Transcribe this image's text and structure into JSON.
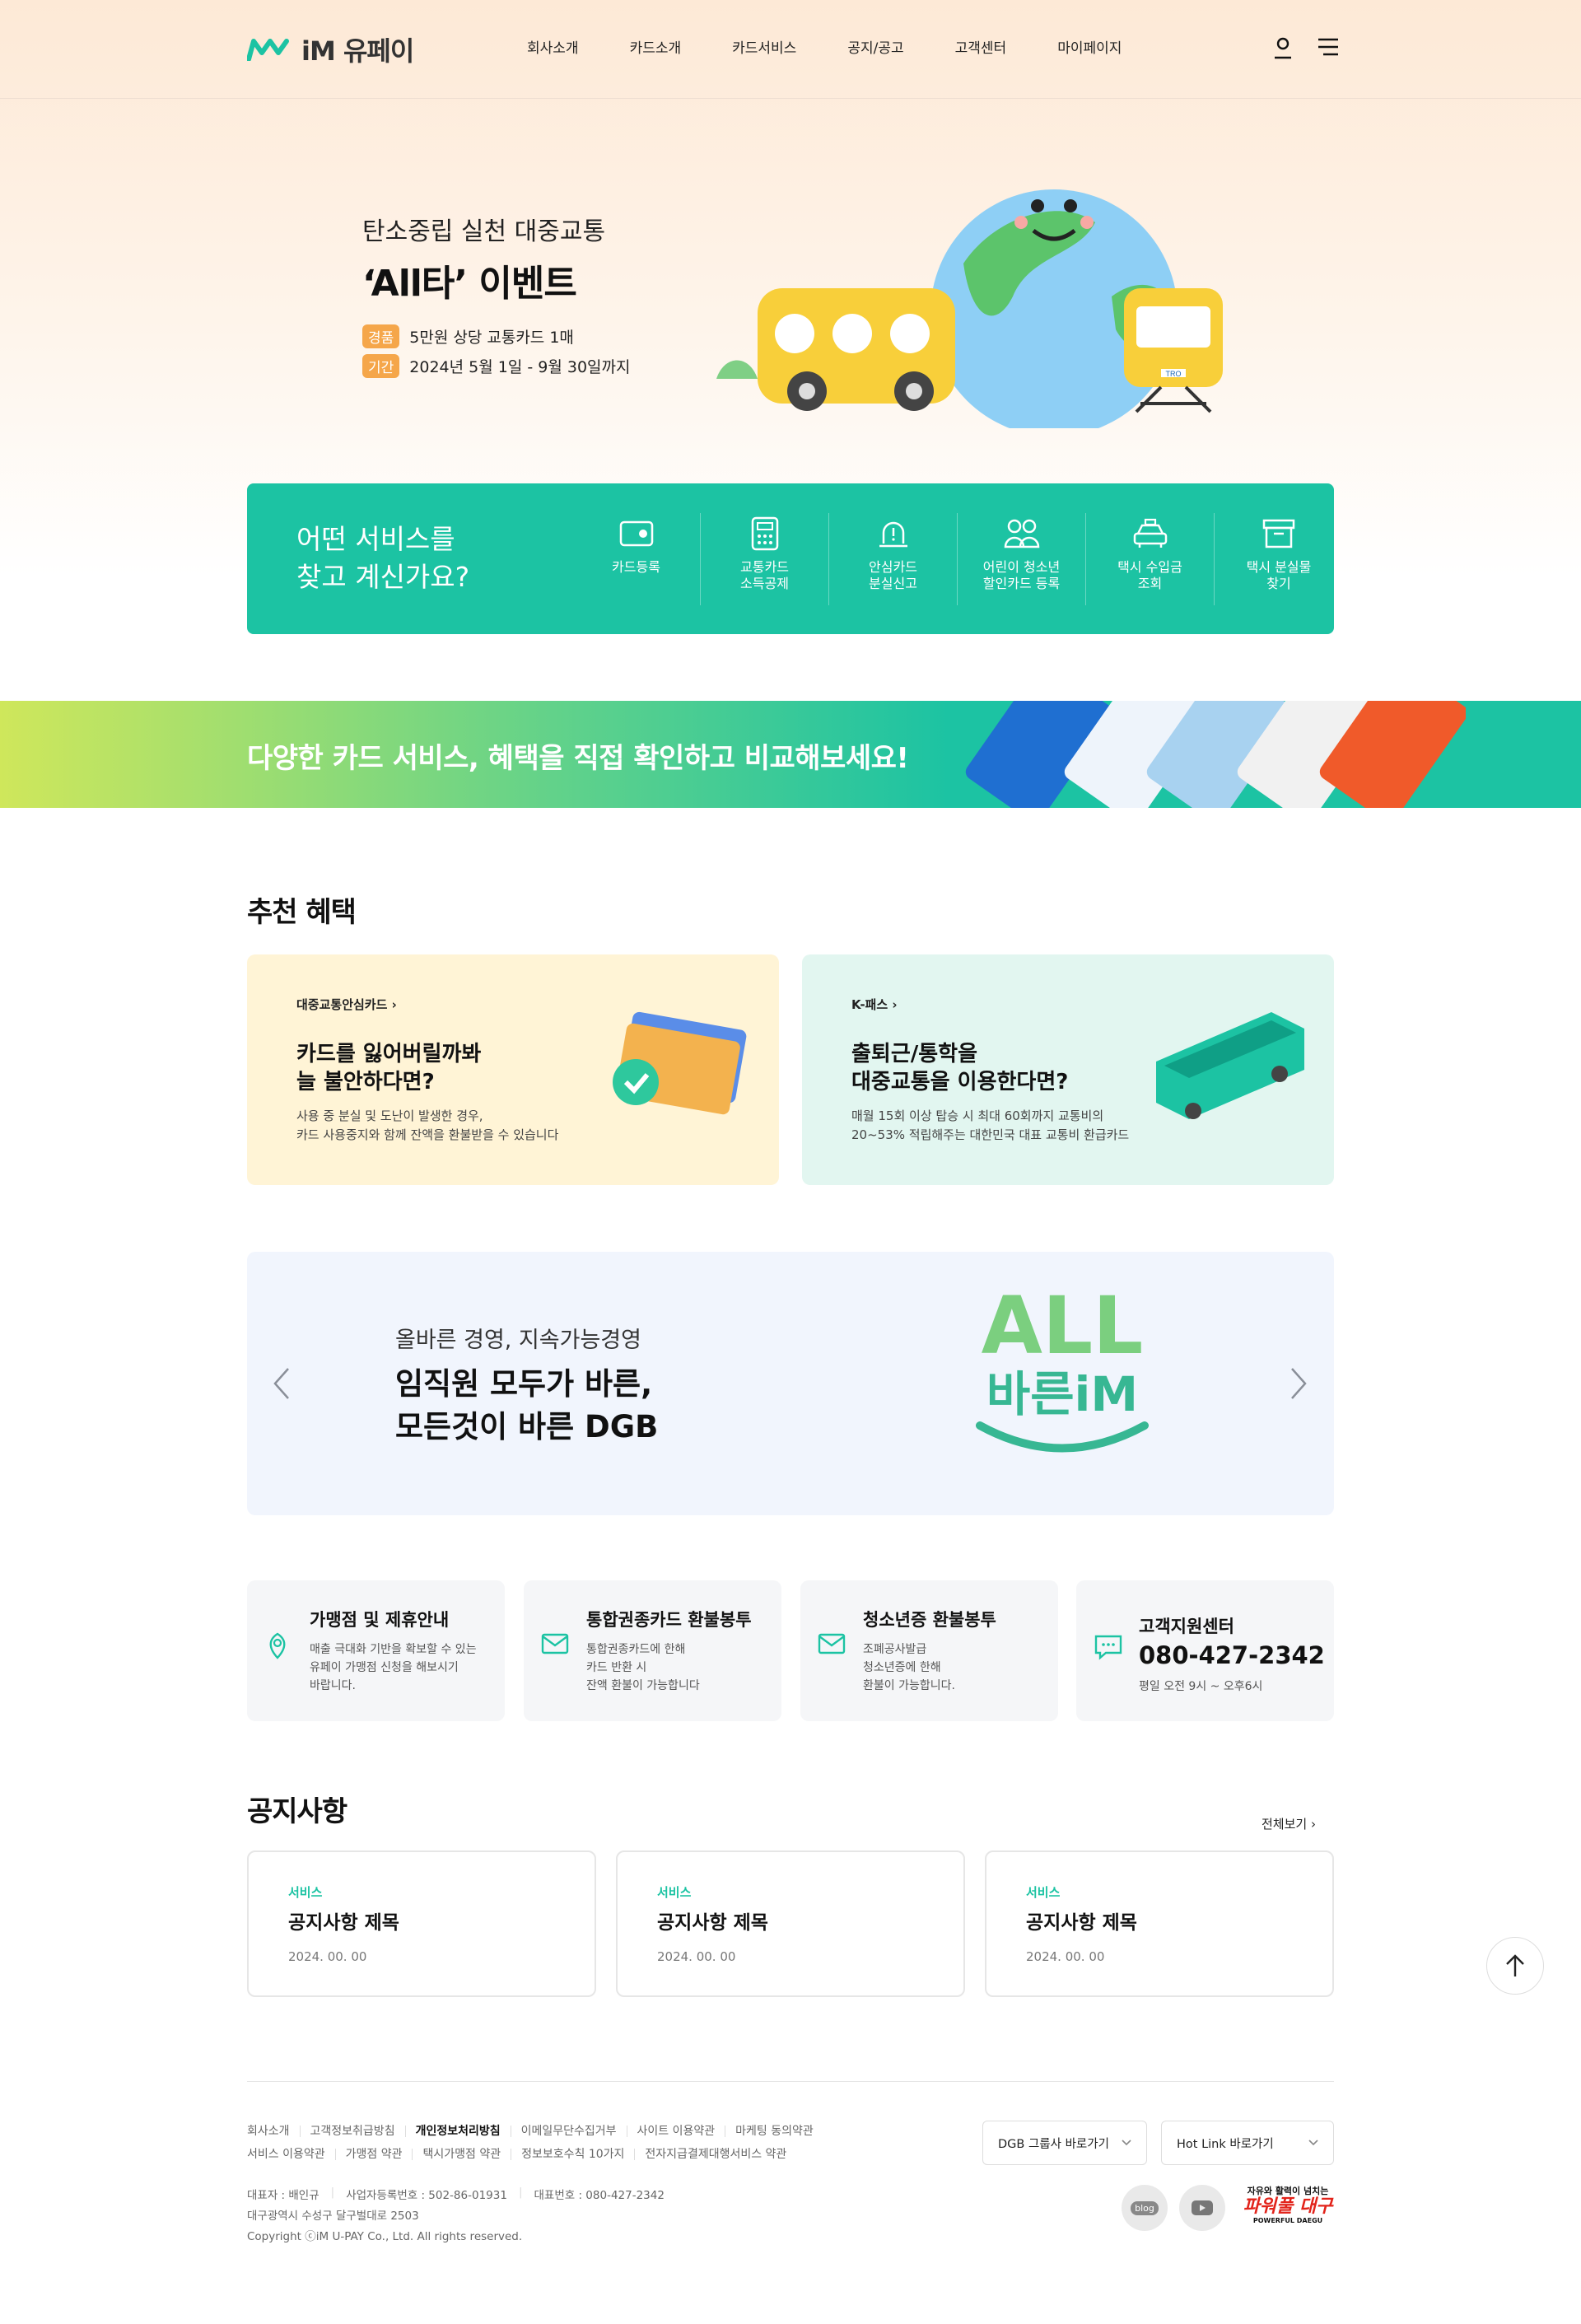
{
  "header": {
    "brand": "iM 유페이",
    "nav": [
      "회사소개",
      "카드소개",
      "카드서비스",
      "공지/공고",
      "고객센터",
      "마이페이지"
    ]
  },
  "hero": {
    "subtitle": "탄소중립 실천 대중교통",
    "title": "‘All타’ 이벤트",
    "prize_tag": "경품",
    "prize": "5만원 상당 교통카드 1매",
    "period_tag": "기간",
    "period": "2024년 5월 1일 - 9월 30일까지",
    "train_label": "TRO"
  },
  "service": {
    "title_line1": "어떤 서비스를",
    "title_line2": "찾고 계신가요?",
    "items": [
      {
        "l1": "카드등록",
        "l2": ""
      },
      {
        "l1": "교통카드",
        "l2": "소득공제"
      },
      {
        "l1": "안심카드",
        "l2": "분실신고"
      },
      {
        "l1": "어린이 청소년",
        "l2": "할인카드 등록"
      },
      {
        "l1": "택시 수입금",
        "l2": "조회"
      },
      {
        "l1": "택시 분실물",
        "l2": "찾기"
      }
    ]
  },
  "band": {
    "text": "다양한 카드 서비스, 혜택을 직접 확인하고 비교해보세요!"
  },
  "benefits": {
    "title": "추천 혜택",
    "cards": [
      {
        "label": "대중교통안심카드",
        "t1": "카드를 잃어버릴까봐",
        "t2": "늘 불안하다면?",
        "d1": "사용 중 분실 및 도난이 발생한 경우,",
        "d2": "카드 사용중지와 함께 잔액을 환불받을 수 있습니다"
      },
      {
        "label": "K-패스",
        "t1": "출퇴근/통학을",
        "t2": "대중교통을 이용한다면?",
        "d1": "매월 15회 이상 탑승 시 최대 60회까지 교통비의",
        "d2": "20~53% 적립해주는 대한민국 대표 교통비 환급카드"
      }
    ]
  },
  "banner": {
    "sub": "올바른 경영, 지속가능경영",
    "t1": "임직원 모두가 바른,",
    "t2": "모든것이 바른 DGB",
    "logo1": "ALL",
    "logo2": "바른iM"
  },
  "info": [
    {
      "title": "가맹점 및 제휴안내",
      "d1": "매출 극대화 기반을 확보할 수 있는",
      "d2": "유페이 가맹점 신청을 해보시기",
      "d3": "바랍니다."
    },
    {
      "title": "통합권종카드 환불봉투",
      "d1": "통합권종카드에 한해",
      "d2": "카드 반환 시",
      "d3": "잔액 환불이 가능합니다"
    },
    {
      "title": "청소년증 환불봉투",
      "d1": "조폐공사발급",
      "d2": "청소년증에 한해",
      "d3": "환불이 가능합니다."
    },
    {
      "title": "고객지원센터",
      "phone": "080-427-2342",
      "hours": "평일 오전 9시 ~ 오후6시"
    }
  ],
  "notices": {
    "title": "공지사항",
    "more": "전체보기",
    "items": [
      {
        "cat": "서비스",
        "title": "공지사항 제목",
        "date": "2024. 00. 00"
      },
      {
        "cat": "서비스",
        "title": "공지사항 제목",
        "date": "2024. 00. 00"
      },
      {
        "cat": "서비스",
        "title": "공지사항 제목",
        "date": "2024. 00. 00"
      }
    ]
  },
  "footer": {
    "links1": [
      "회사소개",
      "고객정보취급방침",
      "개인정보처리방침",
      "이메일무단수집거부",
      "사이트 이용약관",
      "마케팅 동의약관"
    ],
    "links2": [
      "서비스 이용약관",
      "가맹점 약관",
      "택시가맹점 약관",
      "정보보호수칙 10가지",
      "전자지급결제대행서비스 약관"
    ],
    "ceo": "대표자 : 배인규",
    "bizno": "사업자등록번호 : 502-86-01931",
    "tel": "대표번호 : 080-427-2342",
    "address": "대구광역시 수성구 달구벌대로 2503",
    "copyright": "Copyright ⓒiM U-PAY Co., Ltd. All rights reserved.",
    "select1": "DGB 그룹사 바로가기",
    "select2": "Hot Link 바로가기",
    "blog": "blog",
    "daegu1": "자유와 활력이 넘치는",
    "daegu2": "파워풀 대구",
    "daegu3": "POWERFUL DAEGU"
  },
  "colors": {
    "accent": "#1cc3a3",
    "orange": "#f5a64a"
  }
}
